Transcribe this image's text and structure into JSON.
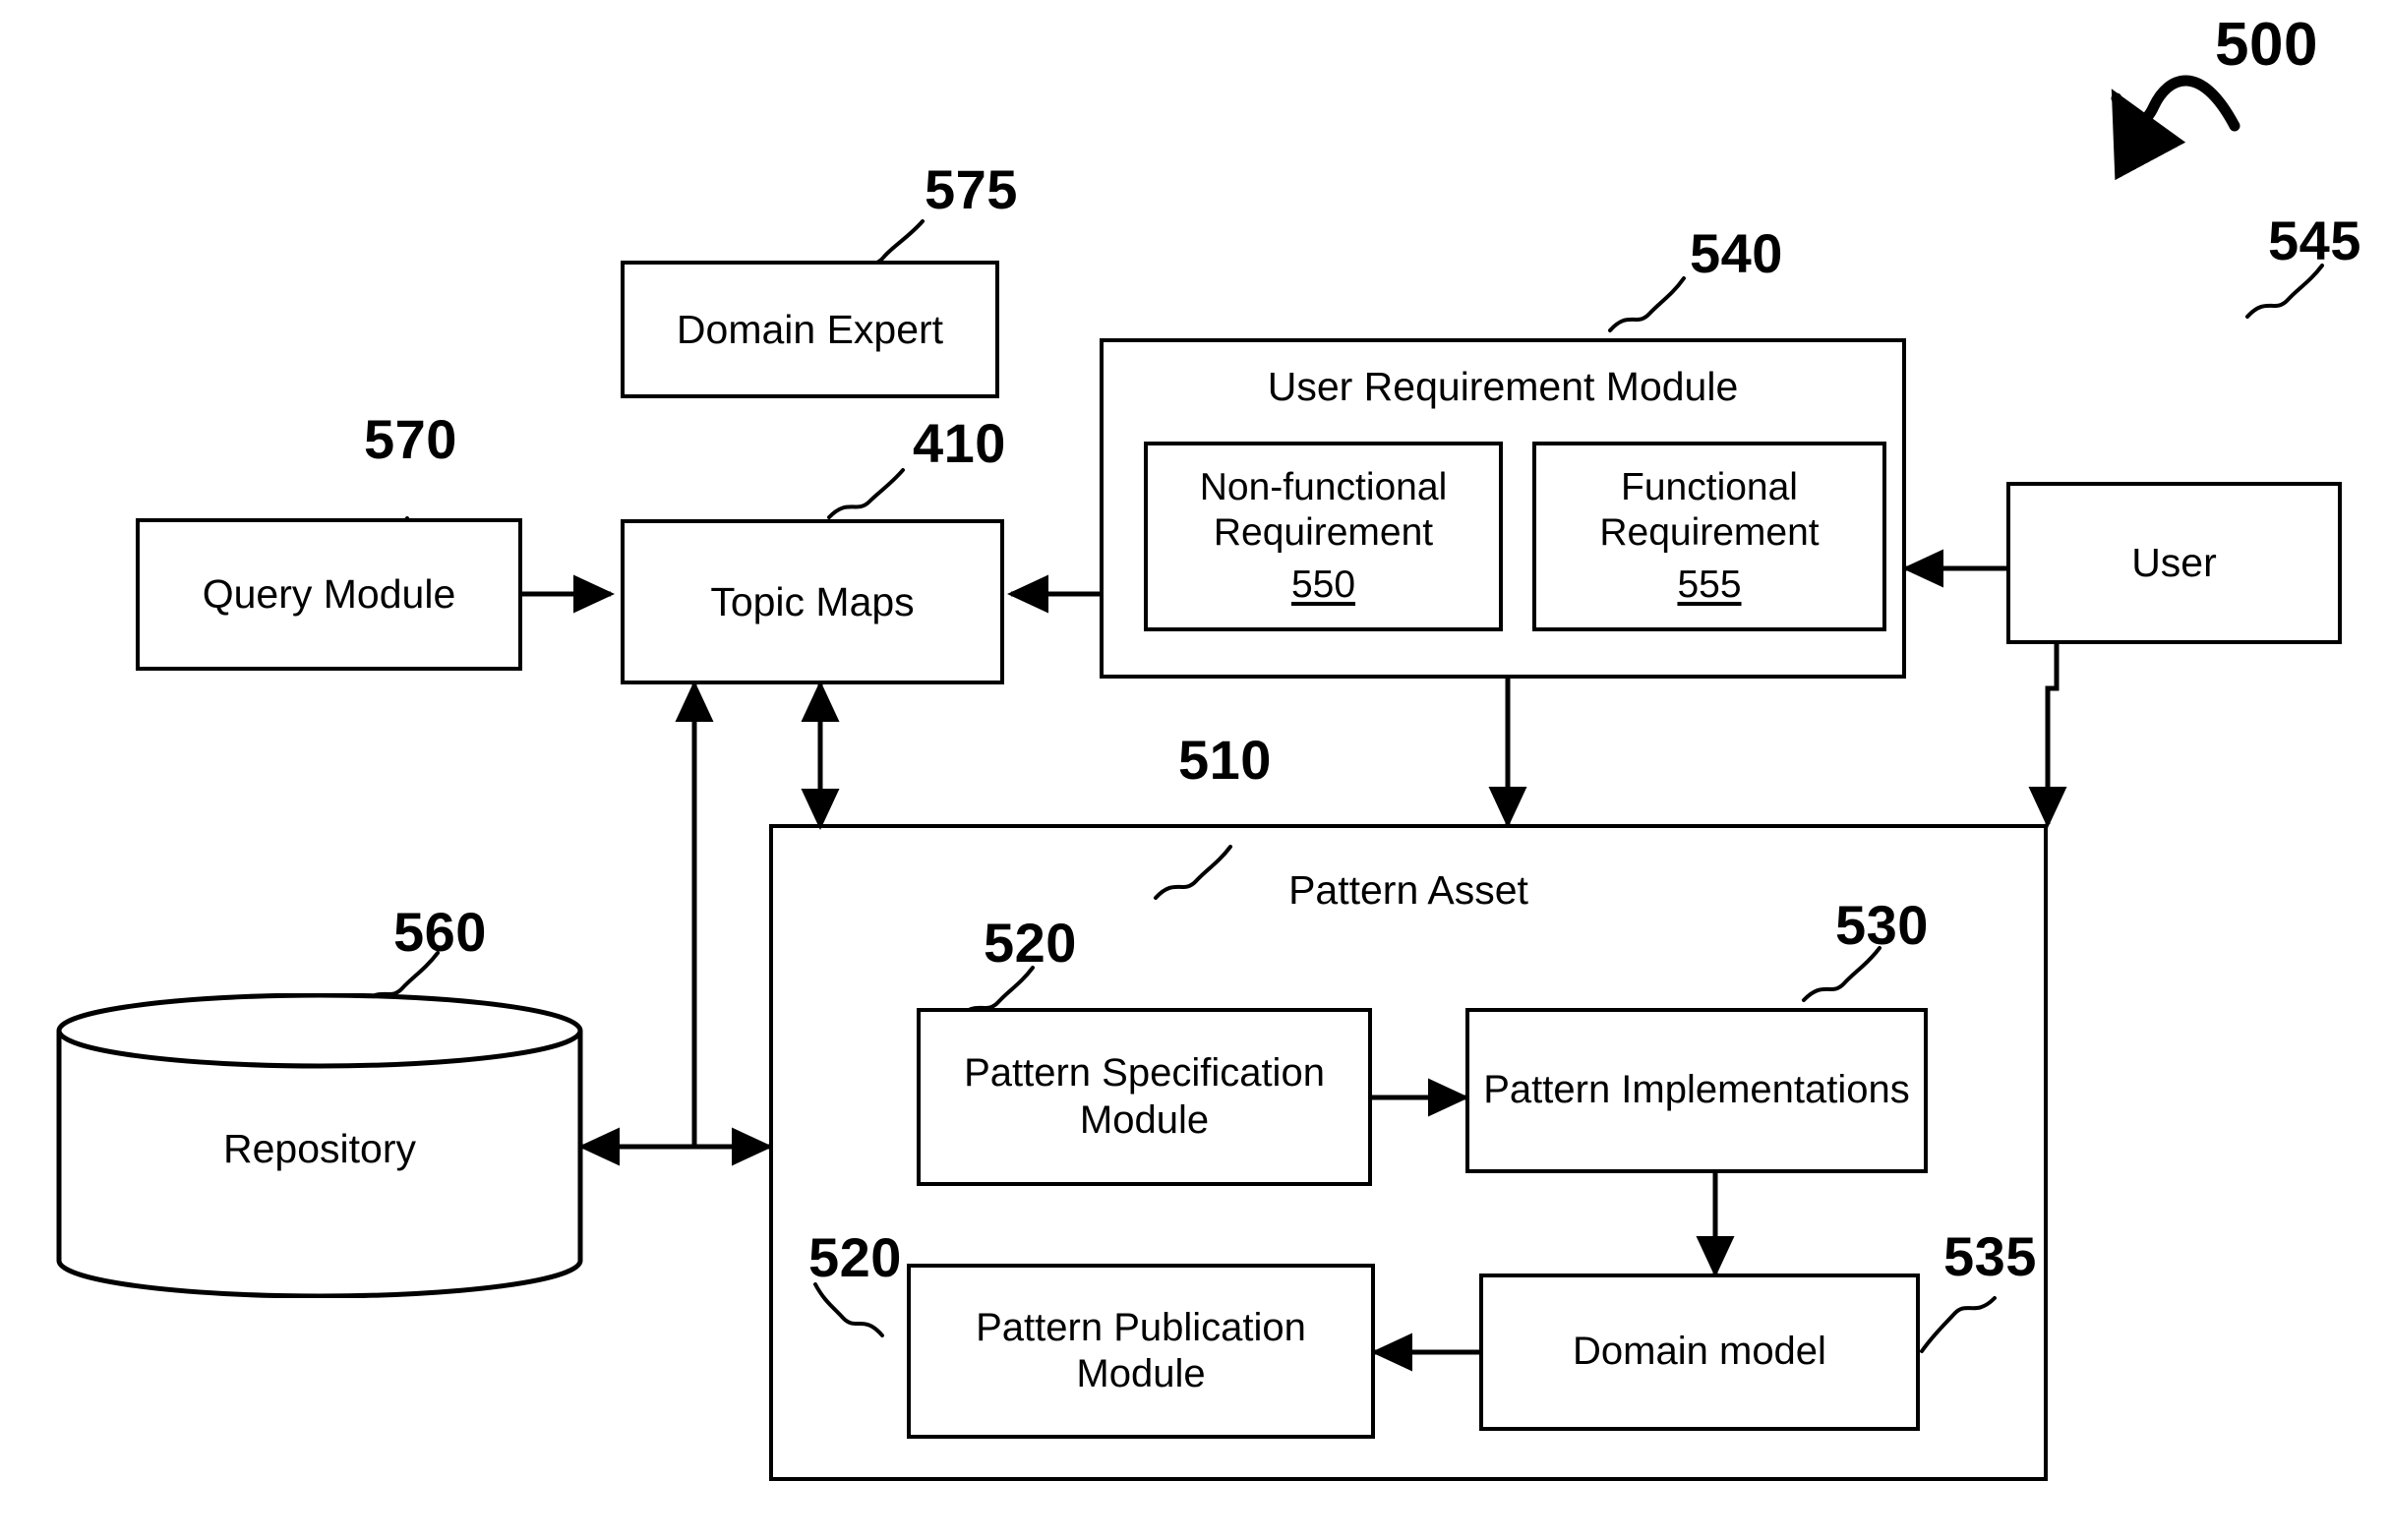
{
  "figure": {
    "figure_ref": "500"
  },
  "nodes": {
    "domain_expert": {
      "label": "Domain Expert",
      "ref": "575"
    },
    "query_module": {
      "label": "Query Module",
      "ref": "570"
    },
    "topic_maps": {
      "label": "Topic Maps",
      "ref": "410"
    },
    "user_requirement_module": {
      "label": "User Requirement Module",
      "ref": "540"
    },
    "non_functional_requirement": {
      "label": "Non-functional Requirement",
      "ref": "550"
    },
    "functional_requirement": {
      "label": "Functional Requirement",
      "ref": "555"
    },
    "user": {
      "label": "User",
      "ref": "545"
    },
    "repository": {
      "label": "Repository",
      "ref": "560"
    },
    "pattern_asset": {
      "label": "Pattern Asset",
      "ref": "510"
    },
    "pattern_specification_module": {
      "label": "Pattern Specification Module",
      "ref": "520"
    },
    "pattern_implementations": {
      "label": "Pattern Implementations",
      "ref": "530"
    },
    "pattern_publication_module": {
      "label": "Pattern Publication Module",
      "ref": "520"
    },
    "domain_model": {
      "label": "Domain model",
      "ref": "535"
    }
  },
  "colors": {
    "line": "#000000",
    "background": "#ffffff"
  }
}
